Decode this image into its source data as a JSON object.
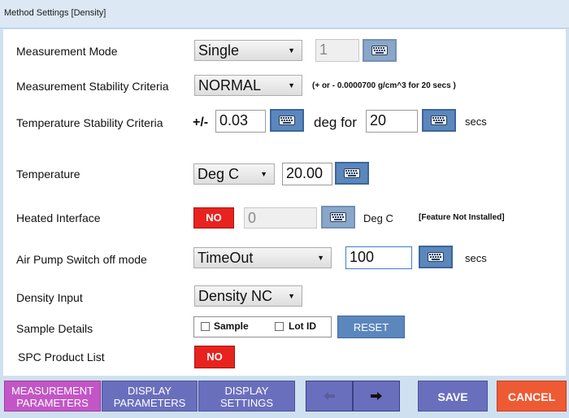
{
  "window": {
    "title": "Method Settings  [Density]"
  },
  "rows": {
    "measurement_mode": {
      "label": "Measurement Mode",
      "value": "Single",
      "count": "1"
    },
    "stability": {
      "label": "Measurement Stability Criteria",
      "value": "NORMAL",
      "note": "(+ or -  0.0000700 g/cm^3 for 20 secs )"
    },
    "temp_stability": {
      "label": "Temperature Stability Criteria",
      "prefix": "+/-",
      "tolerance": "0.03",
      "unit_text": "deg for",
      "seconds": "20",
      "seconds_unit": "secs"
    },
    "temperature": {
      "label": "Temperature",
      "unit": "Deg C",
      "value": "20.00"
    },
    "heated_interface": {
      "label": "Heated Interface",
      "state": "NO",
      "value": "0",
      "unit": "Deg C",
      "note": "[Feature Not Installed]"
    },
    "air_pump": {
      "label": "Air Pump Switch off mode",
      "mode": "TimeOut",
      "value": "100",
      "unit": "secs"
    },
    "density_input": {
      "label": "Density Input",
      "value": "Density NC"
    },
    "sample_details": {
      "label": "Sample Details",
      "sample": "Sample",
      "lot_id": "Lot ID",
      "reset": "RESET"
    },
    "spc": {
      "label": "SPC Product List",
      "state": "NO"
    }
  },
  "bottom": {
    "tab1": {
      "line1": "MEASUREMENT",
      "line2": "PARAMETERS"
    },
    "tab2": {
      "line1": "DISPLAY",
      "line2": "PARAMETERS"
    },
    "tab3": {
      "line1": "DISPLAY",
      "line2": "SETTINGS"
    },
    "save": "SAVE",
    "cancel": "CANCEL"
  },
  "icons": {
    "keyboard": "keyboard-icon",
    "dropdown": "chevron-down-icon",
    "prev": "arrow-left-icon",
    "next": "arrow-right-icon",
    "checkbox": "checkbox-icon"
  },
  "colors": {
    "accent_blue": "#5b87bd",
    "tab_purple": "#6a6fbd",
    "tab_active": "#c356c6",
    "no_red": "#e8231f",
    "cancel_orange": "#ee5a33"
  }
}
